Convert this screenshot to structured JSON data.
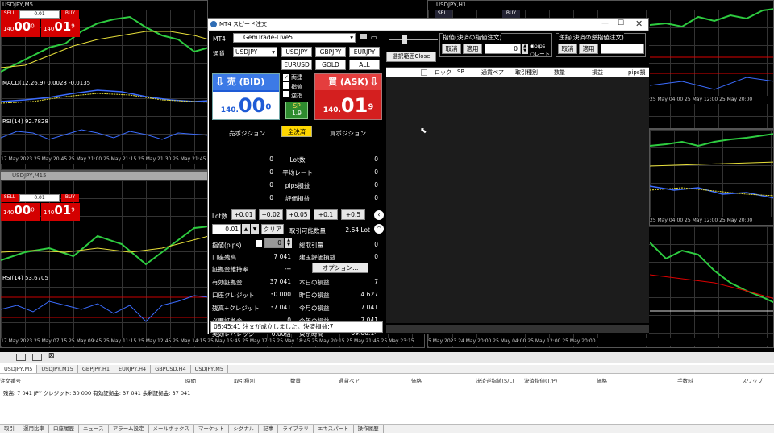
{
  "left_top": {
    "title": "USDJPY,M5",
    "sell": "SELL",
    "buy": "BUY",
    "lot": "0.01",
    "bid_big": "00",
    "bid_pre": "140",
    "bid_sup": "0",
    "ask_big": "01",
    "ask_pre": "140",
    "ask_sup": "9",
    "osc1": "MACD(12,26,9) 0.0028 -0.0135",
    "osc2": "RSI(14) 92.7828",
    "axis": "17 May 2023   25 May 20:45   25 May 21:00   25 May 21:15   25 May 21:30   25 May 21:45   25 May 22:00   25 May 22:15   25 May 22:30   25 May 22:45   25 May 23:00   25 May 23:15"
  },
  "left_bottom": {
    "title": "USDJPY,M15",
    "sell": "SELL",
    "buy": "BUY",
    "lot": "0.01",
    "bid_big": "00",
    "bid_pre": "140",
    "bid_sup": "0",
    "ask_big": "01",
    "ask_pre": "140",
    "ask_sup": "9",
    "osc": "RSI(14) 53.6705",
    "axis": "17 May 2023   25 May 07:15   25 May 09:45   25 May 11:15   25 May 12:45   25 May 14:15   25 May 15:45   25 May 17:15   25 May 18:45   25 May 20:15   25 May 21:45   25 May 23:15"
  },
  "right_top": {
    "title": "USDJPY,H1",
    "sell": "SELL",
    "buy": "BUY",
    "axis": "25 May 04:00   25 May 12:00   25 May 20:00"
  },
  "right_mid": {
    "axis": "25 May 04:00   25 May 12:00   25 May 20:00"
  },
  "right_bottom": {
    "title": "GBPJPY,H1",
    "axis": "5 May 2023   24 May 20:00   25 May 04:00   25 May 12:00   25 May 20:00"
  },
  "dialog": {
    "title": "MT4 スピード注文",
    "platform": "MT4",
    "account": "GemTrade-Live5",
    "symbol_label": "通貨",
    "symbol": "USDJPY",
    "quick_symbols": [
      "USDJPY",
      "GBPJPY",
      "EURJPY",
      "EURUSD",
      "GOLD",
      "ALL"
    ],
    "sell_label": "売 (BID)",
    "sell_pre": "140.",
    "sell_big": "00",
    "sell_sup": "0",
    "buy_label": "買 (ASK)",
    "buy_pre": "140.",
    "buy_big": "01",
    "buy_sup": "9",
    "checks": [
      "両建",
      "指値",
      "逆指"
    ],
    "spread_label": "SP",
    "spread": "1.9",
    "sell_pos": "売ポジション",
    "close_all": "全決済",
    "buy_pos": "買ポジション",
    "pos_rows": [
      {
        "l": "0",
        "label": "Lot数",
        "r": "0"
      },
      {
        "l": "0",
        "label": "平均レート",
        "r": "0"
      },
      {
        "l": "0",
        "label": "pips損益",
        "r": "0"
      },
      {
        "l": "0",
        "label": "評価損益",
        "r": "0"
      }
    ],
    "lot_label": "Lot数",
    "lot_steps": [
      "+0.01",
      "+0.02",
      "+0.05",
      "+0.1",
      "+0.5"
    ],
    "lot_value": "0.01",
    "clear": "クリア",
    "tradable_label": "取引可能数量",
    "tradable": "2.64 Lot",
    "limit_label": "指値(pips)",
    "limit_value": "0",
    "total_label": "総取引量",
    "total": "0",
    "balance_label": "口座残高",
    "balance": "7 041",
    "unreal_label": "建玉評価損益",
    "unreal": "0",
    "margin_label": "証拠金維持率",
    "margin": "---",
    "option": "オプション...",
    "rows2": [
      {
        "a": "有効証拠金",
        "av": "37 041",
        "b": "本日の損益",
        "bv": "7"
      },
      {
        "a": "口座クレジット",
        "av": "30 000",
        "b": "昨日の損益",
        "bv": "4 627"
      },
      {
        "a": "残高+クレジット",
        "av": "37 041",
        "b": "今月の損益",
        "bv": "7 041"
      },
      {
        "a": "必要証拠金",
        "av": "0",
        "b": "今年の損益",
        "bv": "7 041"
      },
      {
        "a": "実効レバレッジ",
        "av": "0.00倍",
        "b": "東京時間",
        "bv": "09:06:14"
      }
    ],
    "status": "08:45:41 注文が成立しました。決済損益:7",
    "range_close": "選択範囲Close",
    "tp_title": "指値(決済の指値注文)",
    "sl_title": "逆指(決済の逆指値注文)",
    "cancel": "取消",
    "apply": "適用",
    "tp_value": "0",
    "pips": "pips",
    "rate": "レート",
    "columns": [
      "ロック",
      "SP",
      "通貨ペア",
      "取引種別",
      "数量",
      "損益",
      "pips損"
    ]
  },
  "terminal": {
    "tabs": [
      "USDJPY,M5",
      "USDJPY,M15",
      "GBPJPY,H1",
      "EURJPY,H4",
      "GBPUSD,H4",
      "USDJPY,M5"
    ],
    "headers": [
      "注文番号",
      "時間",
      "取引種別",
      "数量",
      "通貨ペア",
      "価格",
      "決済逆指値(S/L)",
      "決済指値(T/P)",
      "価格",
      "手数料",
      "スワップ"
    ],
    "summary": "残高: 7 041 JPY  クレジット: 30 000  有効証拠金: 37 041  余剰証拠金: 37 041",
    "bottom_tabs": [
      "取引",
      "運用比率",
      "口座履歴",
      "ニュース",
      "アラーム設定",
      "メールボックス",
      "マーケット",
      "シグナル",
      "記事",
      "ライブラリ",
      "エキスパート",
      "操作履歴"
    ]
  }
}
